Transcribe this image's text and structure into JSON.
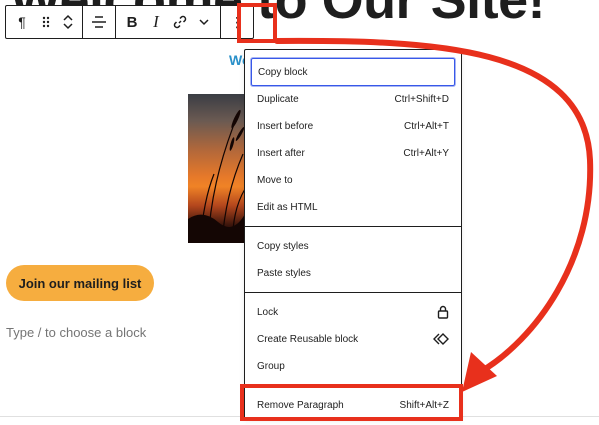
{
  "page": {
    "background_title": "Welcome to Our Site!",
    "link_text": "Wo",
    "mailing_button_label": "Join our mailing list",
    "block_placeholder": "Type / to choose a block"
  },
  "toolbar": {
    "paragraph_icon": "¶",
    "bold_label": "B",
    "italic_label": "I",
    "options_icon": "⋮"
  },
  "menu": {
    "items": [
      {
        "label": "Copy block",
        "shortcut": ""
      },
      {
        "label": "Duplicate",
        "shortcut": "Ctrl+Shift+D"
      },
      {
        "label": "Insert before",
        "shortcut": "Ctrl+Alt+T"
      },
      {
        "label": "Insert after",
        "shortcut": "Ctrl+Alt+Y"
      },
      {
        "label": "Move to",
        "shortcut": ""
      },
      {
        "label": "Edit as HTML",
        "shortcut": ""
      },
      {
        "label": "Copy styles",
        "shortcut": ""
      },
      {
        "label": "Paste styles",
        "shortcut": ""
      },
      {
        "label": "Lock",
        "shortcut": ""
      },
      {
        "label": "Create Reusable block",
        "shortcut": ""
      },
      {
        "label": "Group",
        "shortcut": ""
      },
      {
        "label": "Remove Paragraph",
        "shortcut": "Shift+Alt+Z"
      }
    ]
  },
  "colors": {
    "annotation": "#e8301c",
    "focus": "#3858e9",
    "mailing_button": "#f6ad3f",
    "link": "#2a90c9"
  },
  "icons": [
    "paragraph-icon",
    "drag-handle-icon",
    "move-up-icon",
    "move-down-icon",
    "align-icon",
    "link-icon",
    "chevron-down-icon",
    "more-options-icon",
    "lock-icon",
    "reusable-block-icon",
    "curved-arrow-icon"
  ]
}
